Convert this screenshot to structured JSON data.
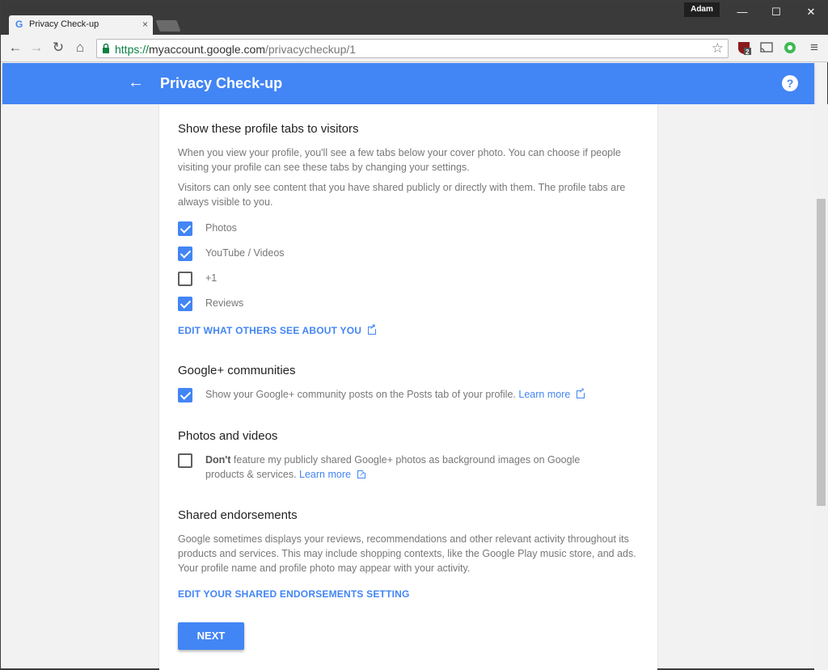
{
  "browser": {
    "tab_title": "Privacy Check-up",
    "tab_favicon": "G",
    "tab_close": "×",
    "user_badge": "Adam",
    "window_minimize": "—",
    "window_maximize": "☐",
    "window_close": "✕",
    "url_scheme": "https://",
    "url_host": "myaccount.google.com",
    "url_path": "/privacycheckup/1",
    "extension_badge": "2"
  },
  "header": {
    "title": "Privacy Check-up",
    "help": "?"
  },
  "sections": {
    "profile_tabs": {
      "title": "Show these profile tabs to visitors",
      "desc1": "When you view your profile, you'll see a few tabs below your cover photo. You can choose if people visiting your profile can see these tabs by changing your settings.",
      "desc2": "Visitors can only see content that you have shared publicly or directly with them. The profile tabs are always visible to you.",
      "options": [
        {
          "label": "Photos",
          "checked": true
        },
        {
          "label": "YouTube / Videos",
          "checked": true
        },
        {
          "label": "+1",
          "checked": false
        },
        {
          "label": "Reviews",
          "checked": true
        }
      ],
      "edit_link": "EDIT WHAT OTHERS SEE ABOUT YOU"
    },
    "communities": {
      "title": "Google+ communities",
      "option_label": "Show your Google+ community posts on the Posts tab of your profile.",
      "learn_more": "Learn more",
      "checked": true
    },
    "photos_videos": {
      "title": "Photos and videos",
      "option_bold": "Don't",
      "option_label": " feature my publicly shared Google+ photos as background images on Google products & services.",
      "learn_more": "Learn more",
      "checked": false
    },
    "endorsements": {
      "title": "Shared endorsements",
      "desc": "Google sometimes displays your reviews, recommendations and other relevant activity throughout its products and services. This may include shopping contexts, like the Google Play music store, and ads. Your profile name and profile photo may appear with your activity.",
      "edit_link": "EDIT YOUR SHARED ENDORSEMENTS SETTING"
    }
  },
  "next_button": "NEXT",
  "colors": {
    "accent": "#4285f4",
    "titlebar": "#3a3a3a"
  }
}
